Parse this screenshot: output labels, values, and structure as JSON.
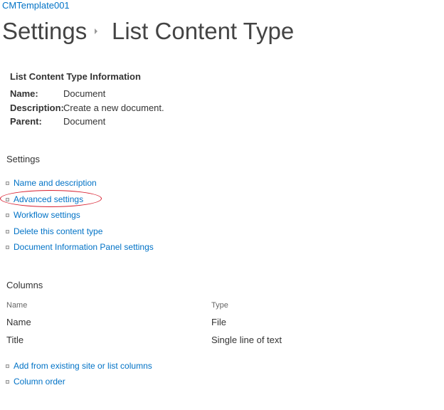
{
  "site": {
    "name": "CMTemplate001"
  },
  "title": {
    "section": "Settings",
    "page": "List Content Type"
  },
  "info": {
    "heading": "List Content Type Information",
    "name_label": "Name:",
    "name_value": "Document",
    "description_label": "Description:",
    "description_value": "Create a new document.",
    "parent_label": "Parent:",
    "parent_value": "Document"
  },
  "settings": {
    "title": "Settings",
    "links": [
      "Name and description",
      "Advanced settings",
      "Workflow settings",
      "Delete this content type",
      "Document Information Panel settings"
    ]
  },
  "columns": {
    "title": "Columns",
    "header_name": "Name",
    "header_type": "Type",
    "rows": [
      {
        "name": "Name",
        "type": "File",
        "name_is_link": false
      },
      {
        "name": "Title",
        "type": "Single line of text",
        "name_is_link": true
      }
    ],
    "links": [
      "Add from existing site or list columns",
      "Column order"
    ]
  },
  "colors": {
    "link": "#0072c6",
    "highlight_oval": "#d82030"
  }
}
